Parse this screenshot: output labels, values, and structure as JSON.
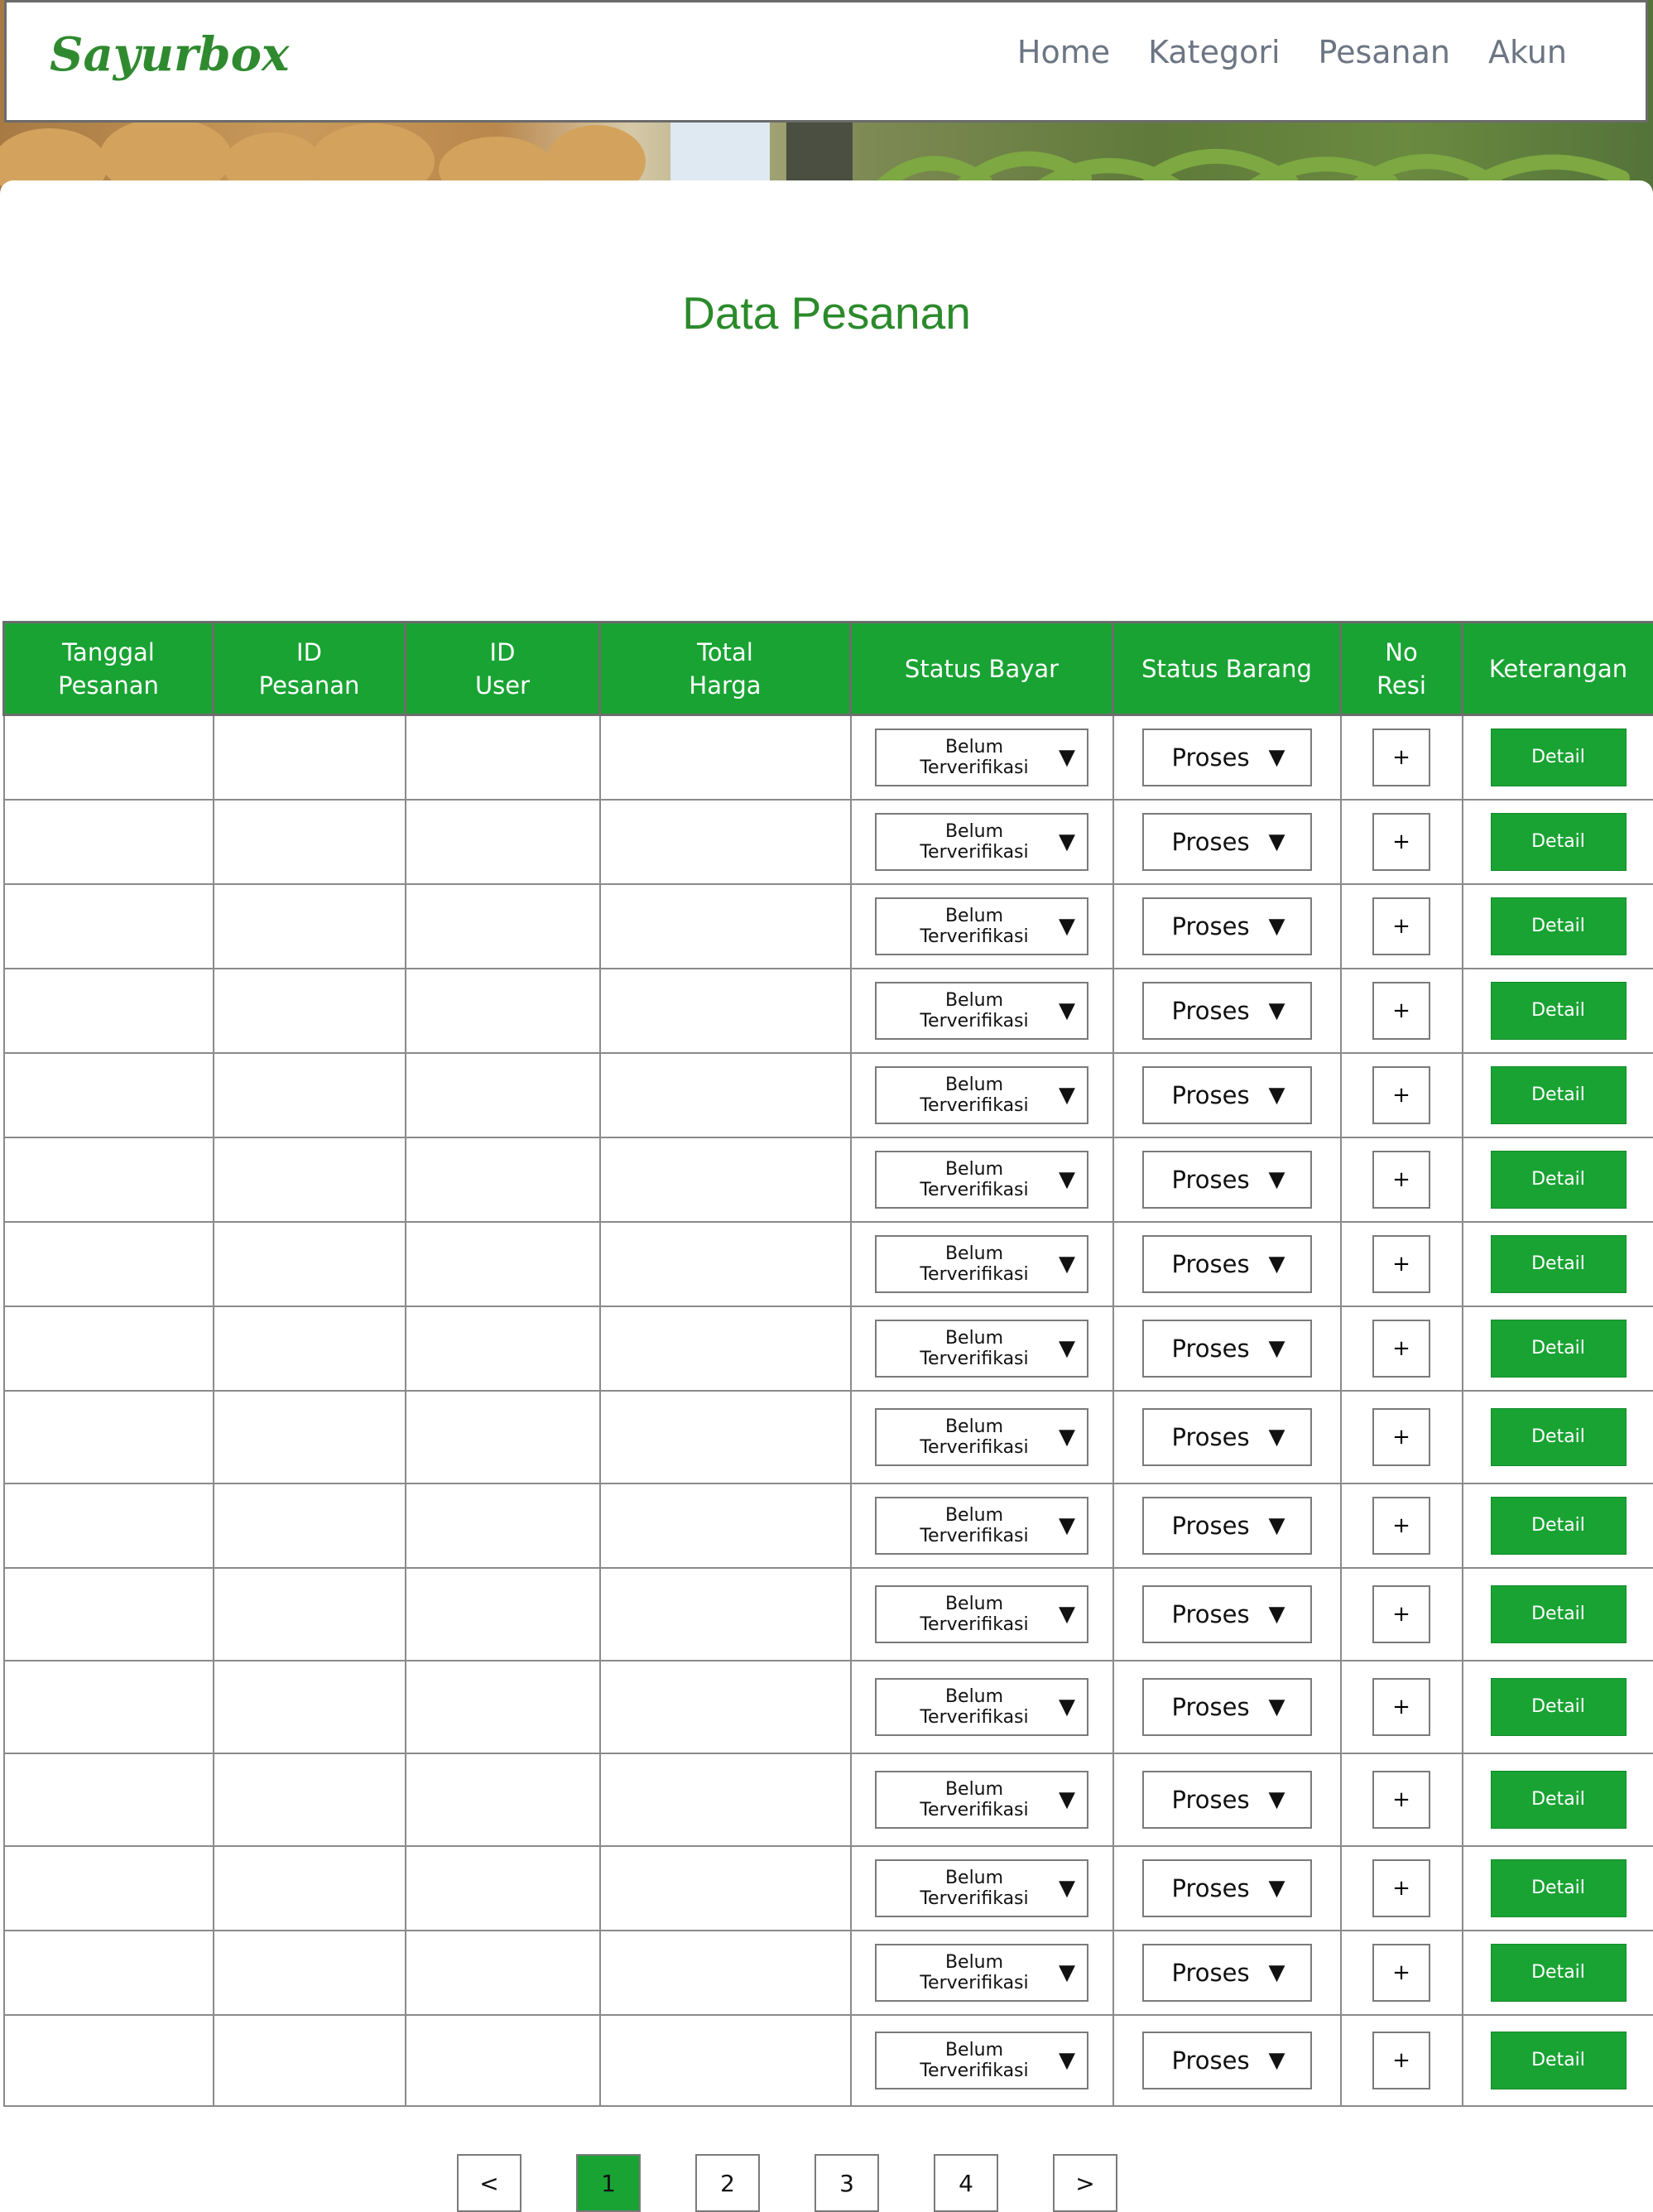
{
  "brand": {
    "logo_text": "Sayurbox",
    "accent_color": "#19a333"
  },
  "nav": {
    "items": [
      "Home",
      "Kategori",
      "Pesanan",
      "Akun"
    ]
  },
  "page": {
    "title": "Data Pesanan"
  },
  "table": {
    "headers": [
      "Tanggal\nPesanan",
      "ID\nPesanan",
      "ID\nUser",
      "Total\nHarga",
      "Status Bayar",
      "Status Barang",
      "No\nResi",
      "Keterangan"
    ],
    "rows": [
      {
        "tanggal": "",
        "id_pesanan": "",
        "id_user": "",
        "total_harga": "",
        "status_bayar": "Belum Terverifikasi",
        "status_barang": "Proses",
        "no_resi": "+",
        "keterangan": "Detail"
      },
      {
        "tanggal": "",
        "id_pesanan": "",
        "id_user": "",
        "total_harga": "",
        "status_bayar": "Belum Terverifikasi",
        "status_barang": "Proses",
        "no_resi": "+",
        "keterangan": "Detail"
      },
      {
        "tanggal": "",
        "id_pesanan": "",
        "id_user": "",
        "total_harga": "",
        "status_bayar": "Belum Terverifikasi",
        "status_barang": "Proses",
        "no_resi": "+",
        "keterangan": "Detail"
      },
      {
        "tanggal": "",
        "id_pesanan": "",
        "id_user": "",
        "total_harga": "",
        "status_bayar": "Belum Terverifikasi",
        "status_barang": "Proses",
        "no_resi": "+",
        "keterangan": "Detail"
      },
      {
        "tanggal": "",
        "id_pesanan": "",
        "id_user": "",
        "total_harga": "",
        "status_bayar": "Belum Terverifikasi",
        "status_barang": "Proses",
        "no_resi": "+",
        "keterangan": "Detail"
      },
      {
        "tanggal": "",
        "id_pesanan": "",
        "id_user": "",
        "total_harga": "",
        "status_bayar": "Belum Terverifikasi",
        "status_barang": "Proses",
        "no_resi": "+",
        "keterangan": "Detail"
      },
      {
        "tanggal": "",
        "id_pesanan": "",
        "id_user": "",
        "total_harga": "",
        "status_bayar": "Belum Terverifikasi",
        "status_barang": "Proses",
        "no_resi": "+",
        "keterangan": "Detail"
      },
      {
        "tanggal": "",
        "id_pesanan": "",
        "id_user": "",
        "total_harga": "",
        "status_bayar": "Belum Terverifikasi",
        "status_barang": "Proses",
        "no_resi": "+",
        "keterangan": "Detail"
      },
      {
        "tanggal": "",
        "id_pesanan": "",
        "id_user": "",
        "total_harga": "",
        "status_bayar": "Belum Terverifikasi",
        "status_barang": "Proses",
        "no_resi": "+",
        "keterangan": "Detail"
      },
      {
        "tanggal": "",
        "id_pesanan": "",
        "id_user": "",
        "total_harga": "",
        "status_bayar": "Belum Terverifikasi",
        "status_barang": "Proses",
        "no_resi": "+",
        "keterangan": "Detail"
      },
      {
        "tanggal": "",
        "id_pesanan": "",
        "id_user": "",
        "total_harga": "",
        "status_bayar": "Belum Terverifikasi",
        "status_barang": "Proses",
        "no_resi": "+",
        "keterangan": "Detail"
      },
      {
        "tanggal": "",
        "id_pesanan": "",
        "id_user": "",
        "total_harga": "",
        "status_bayar": "Belum Terverifikasi",
        "status_barang": "Proses",
        "no_resi": "+",
        "keterangan": "Detail"
      },
      {
        "tanggal": "",
        "id_pesanan": "",
        "id_user": "",
        "total_harga": "",
        "status_bayar": "Belum Terverifikasi",
        "status_barang": "Proses",
        "no_resi": "+",
        "keterangan": "Detail"
      },
      {
        "tanggal": "",
        "id_pesanan": "",
        "id_user": "",
        "total_harga": "",
        "status_bayar": "Belum Terverifikasi",
        "status_barang": "Proses",
        "no_resi": "+",
        "keterangan": "Detail"
      },
      {
        "tanggal": "",
        "id_pesanan": "",
        "id_user": "",
        "total_harga": "",
        "status_bayar": "Belum Terverifikasi",
        "status_barang": "Proses",
        "no_resi": "+",
        "keterangan": "Detail"
      },
      {
        "tanggal": "",
        "id_pesanan": "",
        "id_user": "",
        "total_harga": "",
        "status_bayar": "Belum Terverifikasi",
        "status_barang": "Proses",
        "no_resi": "+",
        "keterangan": "Detail"
      }
    ],
    "dropdown_icon": "caret-down-icon",
    "caret_glyph": "▼"
  },
  "pagination": {
    "prev": "<",
    "pages": [
      "1",
      "2",
      "3",
      "4"
    ],
    "current": "1",
    "next": ">"
  }
}
